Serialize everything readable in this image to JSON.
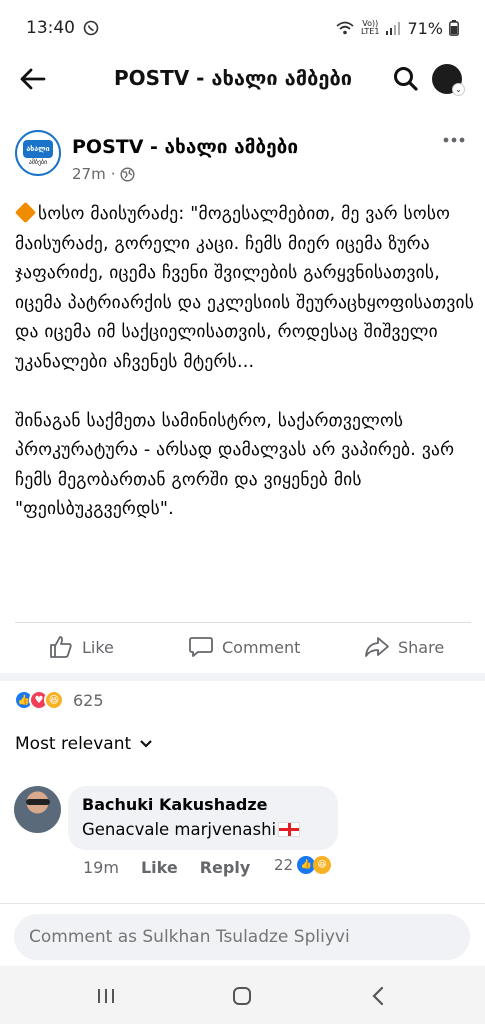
{
  "status_bar": {
    "time": "13:40",
    "volte_label": "Vo))\nLTE1",
    "battery": "71%"
  },
  "app_bar": {
    "title": "POSTV - ახალი ამბები",
    "icons": [
      "back-arrow-icon",
      "search-icon",
      "profile-avatar"
    ]
  },
  "post": {
    "page_name": "POSTV - ახალი ამბები",
    "logo_text": "ახალი",
    "logo_sub": "ამბები",
    "time": "27m",
    "privacy_icon": "globe-icon",
    "body": "სოსო მაისურაძე:  \"მოგესალმებით, მე ვარ სოსო მაისურაძე, გორელი კაცი. ჩემს მიერ იცემა ზურა ჯაფარიძე, იცემა ჩვენი შვილების გარყვნისათვის, იცემა პატრიარქის და ეკლესიის შეურაცხყოფისათვის და იცემა იმ საქციელისათვის, როდესაც შიშველი უკანალები აჩვენეს მტერს...\n\n შინაგან საქმეთა სამინისტრო, საქართველოს პროკურატურა - არსად დამალვას არ ვაპირებ. ვარ ჩემს მეგობართან გორში და ვიყენებ მის \"ფეისბუკგვერდს\".",
    "actions": {
      "like": "Like",
      "comment": "Comment",
      "share": "Share"
    },
    "reaction_count": "625"
  },
  "comments": {
    "sort_label": "Most relevant",
    "items": [
      {
        "author": "Bachuki Kakushadze",
        "text": "Genacvale marjvenashi",
        "time": "19m",
        "like_label": "Like",
        "reply_label": "Reply",
        "reaction_count": "22"
      }
    ]
  },
  "composer": {
    "placeholder": "Comment as Sulkhan Tsuladze Spliyvi"
  },
  "colors": {
    "fb_blue": "#1877f2",
    "love_red": "#f33e58",
    "haha_yellow": "#f7b125",
    "secondary_text": "#65676b"
  }
}
